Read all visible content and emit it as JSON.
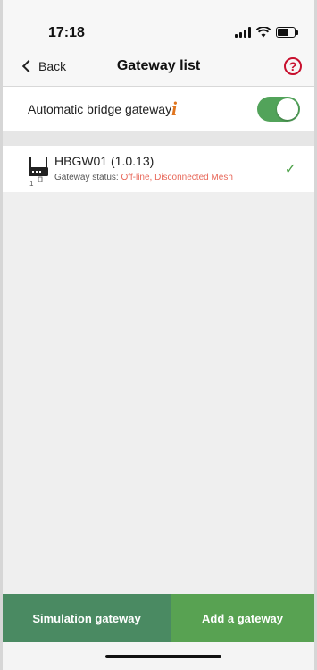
{
  "status_bar": {
    "time": "17:18"
  },
  "nav": {
    "back_label": "Back",
    "title": "Gateway list",
    "help_icon": "?"
  },
  "auto_bridge": {
    "label": "Automatic bridge gateway",
    "info_icon": "i",
    "toggle_on": true
  },
  "gateways": [
    {
      "name": "HBGW01 (1.0.13)",
      "status_prefix": "Gateway status: ",
      "status_offline": "Off-line",
      "status_separator": ", ",
      "status_mesh": "Disconnected Mesh",
      "icon_label": "1",
      "selected": true,
      "check": "✓"
    }
  ],
  "buttons": {
    "simulation": "Simulation gateway",
    "add": "Add a gateway"
  },
  "colors": {
    "toggle_green": "#52a35a",
    "status_red": "#e8685a",
    "simulation_button": "#4a8a62",
    "add_button": "#58a252",
    "help_red": "#c8102e",
    "info_orange": "#e0751e"
  }
}
